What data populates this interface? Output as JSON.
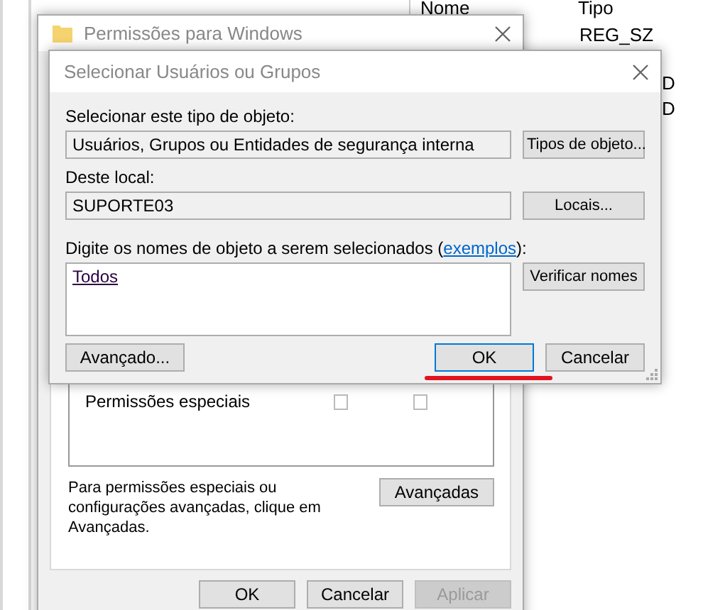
{
  "background": {
    "column_headers": [
      "Nome",
      "Tipo"
    ],
    "values": [
      "REG_SZ",
      "D",
      "D"
    ]
  },
  "permissions_window": {
    "title": "Permissões para Windows",
    "rows": [
      {
        "label": "Permissões especiais",
        "allow_checked": false,
        "deny_checked": false
      }
    ],
    "advanced_note": "Para permissões especiais ou configurações avançadas, clique em Avançadas.",
    "advanced_button": "Avançadas",
    "buttons": [
      {
        "label": "OK",
        "disabled": false
      },
      {
        "label": "Cancelar",
        "disabled": false
      },
      {
        "label": "Aplicar",
        "disabled": true
      }
    ]
  },
  "dialog": {
    "title": "Selecionar Usuários ou Grupos",
    "object_type_label": "Selecionar este tipo de objeto:",
    "object_type_value": "Usuários, Grupos ou Entidades de segurança interna",
    "object_types_button": "Tipos de objeto...",
    "location_label": "Deste local:",
    "location_value": "SUPORTE03",
    "locations_button": "Locais...",
    "names_label_before": "Digite os nomes de objeto a serem selecionados (",
    "names_link": "exemplos",
    "names_label_after": "):",
    "names_value": "Todos",
    "check_names_button": "Verificar nomes",
    "advanced_button": "Avançado...",
    "ok_button": "OK",
    "cancel_button": "Cancelar"
  }
}
